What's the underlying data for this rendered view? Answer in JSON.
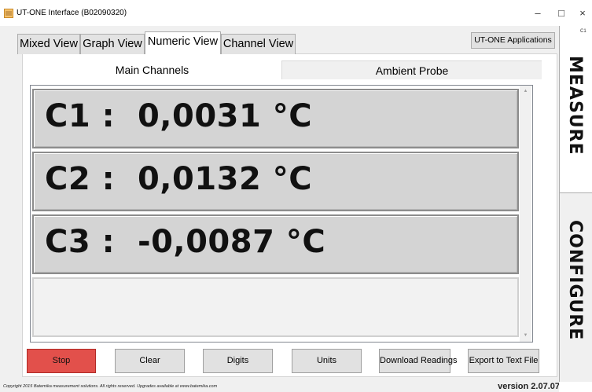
{
  "window": {
    "title": "UT-ONE Interface (B02090320)",
    "minimize": "–",
    "maximize": "□",
    "close": "×"
  },
  "tabs": [
    {
      "label": "Mixed View",
      "active": false
    },
    {
      "label": "Graph View",
      "active": false
    },
    {
      "label": "Numeric View",
      "active": true
    },
    {
      "label": "Channel View",
      "active": false
    }
  ],
  "apps_button": "UT-ONE Applications",
  "subtabs": [
    {
      "label": "Main Channels",
      "active": true
    },
    {
      "label": "Ambient Probe",
      "active": false
    }
  ],
  "channels": [
    {
      "label": "C1 :  0,0031 °C"
    },
    {
      "label": "C2 :  0,0132 °C"
    },
    {
      "label": "C3 :  -0,0087 °C"
    }
  ],
  "buttons": {
    "stop": "Stop",
    "clear": "Clear",
    "digits": "Digits",
    "units": "Units",
    "download": "Download Readings",
    "export": "Export to Text File"
  },
  "colors": {
    "stop_button": "#e2504b",
    "channel_bg": "#d4d4d4"
  },
  "footer": {
    "copyright": "Copyright 2015 Batemika measurement solutions. All rights reserved. Upgrades available at www.batemika.com",
    "version": "version 2.07.07"
  },
  "side": {
    "badge": "C1",
    "measure": "MEASURE",
    "configure": "CONFIGURE"
  }
}
